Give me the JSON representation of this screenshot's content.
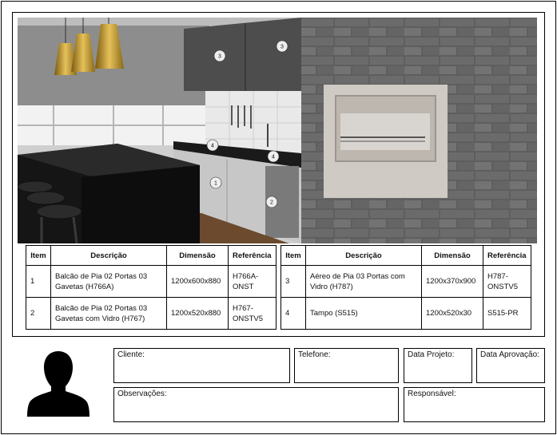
{
  "markers": [
    "3",
    "3",
    "4",
    "4",
    "1",
    "2"
  ],
  "table_left": {
    "headers": [
      "Item",
      "Descrição",
      "Dimensão",
      "Referência"
    ],
    "rows": [
      {
        "item": "1",
        "descricao": "Balcão de Pia 02 Portas 03 Gavetas (H766A)",
        "dimensao": "1200x600x880",
        "referencia": "H766A-ONST"
      },
      {
        "item": "2",
        "descricao": "Balcão de Pia 02 Portas 03 Gavetas com Vidro (H767)",
        "dimensao": "1200x520x880",
        "referencia": "H767-ONSTV5"
      }
    ]
  },
  "table_right": {
    "headers": [
      "Item",
      "Descrição",
      "Dimensão",
      "Referência"
    ],
    "rows": [
      {
        "item": "3",
        "descricao": "Aéreo de Pia 03 Portas com Vidro (H787)",
        "dimensao": "1200x370x900",
        "referencia": "H787-ONSTV5"
      },
      {
        "item": "4",
        "descricao": "Tampo (S515)",
        "dimensao": "1200x520x30",
        "referencia": "S515-PR"
      }
    ]
  },
  "form": {
    "cliente": "Cliente:",
    "telefone": "Telefone:",
    "data_projeto": "Data Projeto:",
    "data_aprovacao": "Data Aprovação:",
    "observacoes": "Observações:",
    "responsavel": "Responsável:"
  }
}
